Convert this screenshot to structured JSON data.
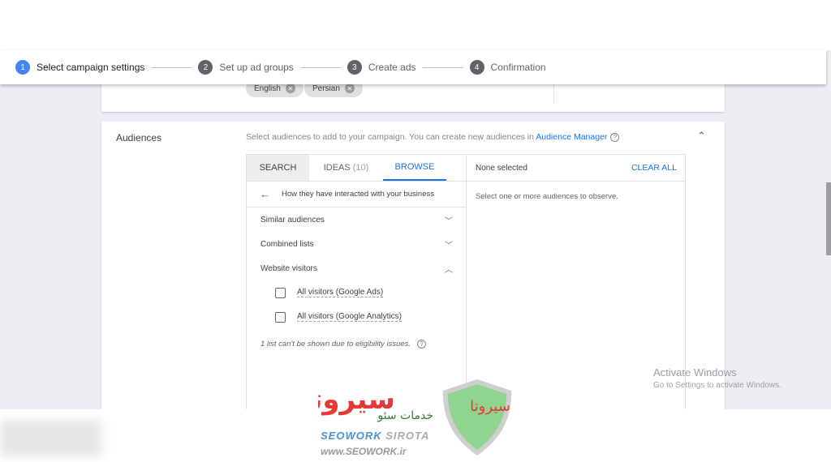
{
  "stepper": {
    "steps": [
      {
        "num": "1",
        "label": "Select campaign settings"
      },
      {
        "num": "2",
        "label": "Set up ad groups"
      },
      {
        "num": "3",
        "label": "Create ads"
      },
      {
        "num": "4",
        "label": "Confirmation"
      }
    ]
  },
  "languages": {
    "chips": [
      "English",
      "Persian"
    ]
  },
  "audiences": {
    "title": "Audiences",
    "description": "Select audiences to add to your campaign. You can create new audiences in ",
    "link": "Audience Manager",
    "tabs": {
      "search": "SEARCH",
      "ideas": "IDEAS",
      "ideas_count": "(10)",
      "browse": "BROWSE"
    },
    "back_label": "How they have interacted with your business",
    "categories": [
      "Similar audiences",
      "Combined lists",
      "Website visitors"
    ],
    "options": [
      "All visitors (Google Ads)",
      "All visitors (Google Analytics)"
    ],
    "note": "1 list can't be shown due to eligibility issues.",
    "selected_header": "None selected",
    "clear_all": "CLEAR ALL",
    "empty_text": "Select one or more audiences to observe."
  },
  "watermark": {
    "line1": "Activate Windows",
    "line2": "Go to Settings to activate Windows."
  },
  "logo": {
    "brand1": "SEOWORK",
    "brand2": "SIROTA",
    "url": "www.SEOWORK.ir",
    "persian": "سیروتا خدمات سئو"
  },
  "colors": {
    "accent": "#1a73e8",
    "step_active": "#4285f4"
  }
}
